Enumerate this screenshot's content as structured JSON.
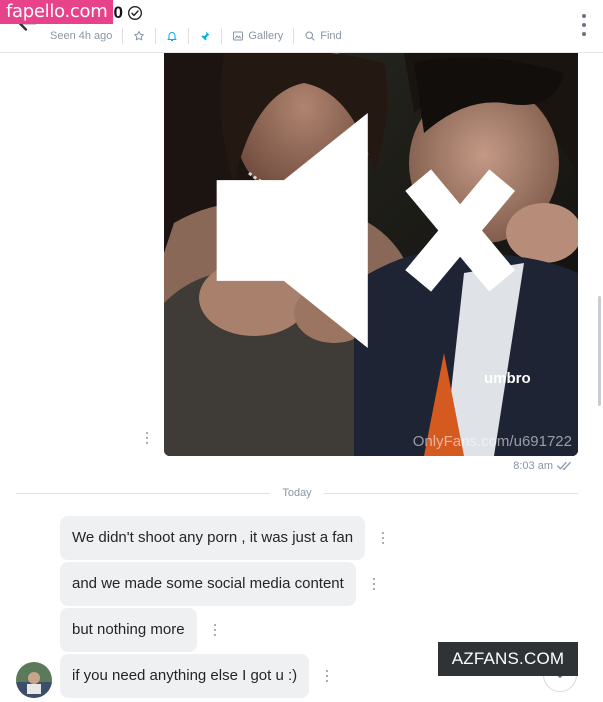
{
  "header": {
    "username": "z0",
    "seen": "Seen 4h ago",
    "toolbar": {
      "gallery_label": "Gallery",
      "find_label": "Find"
    }
  },
  "overlays": {
    "logo_text": "fapello.com",
    "bottom_watermark": "AZFANS.COM"
  },
  "media_message": {
    "watermark": "OnlyFans.com/u691722",
    "time": "8:03 am"
  },
  "divider": {
    "label": "Today"
  },
  "messages": [
    {
      "text": "We didn't shoot any porn , it was just a fan"
    },
    {
      "text": "and we made some social media content"
    },
    {
      "text": "but nothing more"
    },
    {
      "text": "if you need anything else I got u :)"
    }
  ],
  "colors": {
    "accent": "#00aff0",
    "bubble": "#eef0f2",
    "muted": "#8a96a3",
    "logo_bg": "#e8438a"
  },
  "icons": [
    "back-arrow-icon",
    "verified-icon",
    "star-icon",
    "bell-icon",
    "pin-icon",
    "gallery-icon",
    "search-icon",
    "more-vertical-icon",
    "mute-icon",
    "double-check-icon",
    "chevron-down-icon"
  ]
}
